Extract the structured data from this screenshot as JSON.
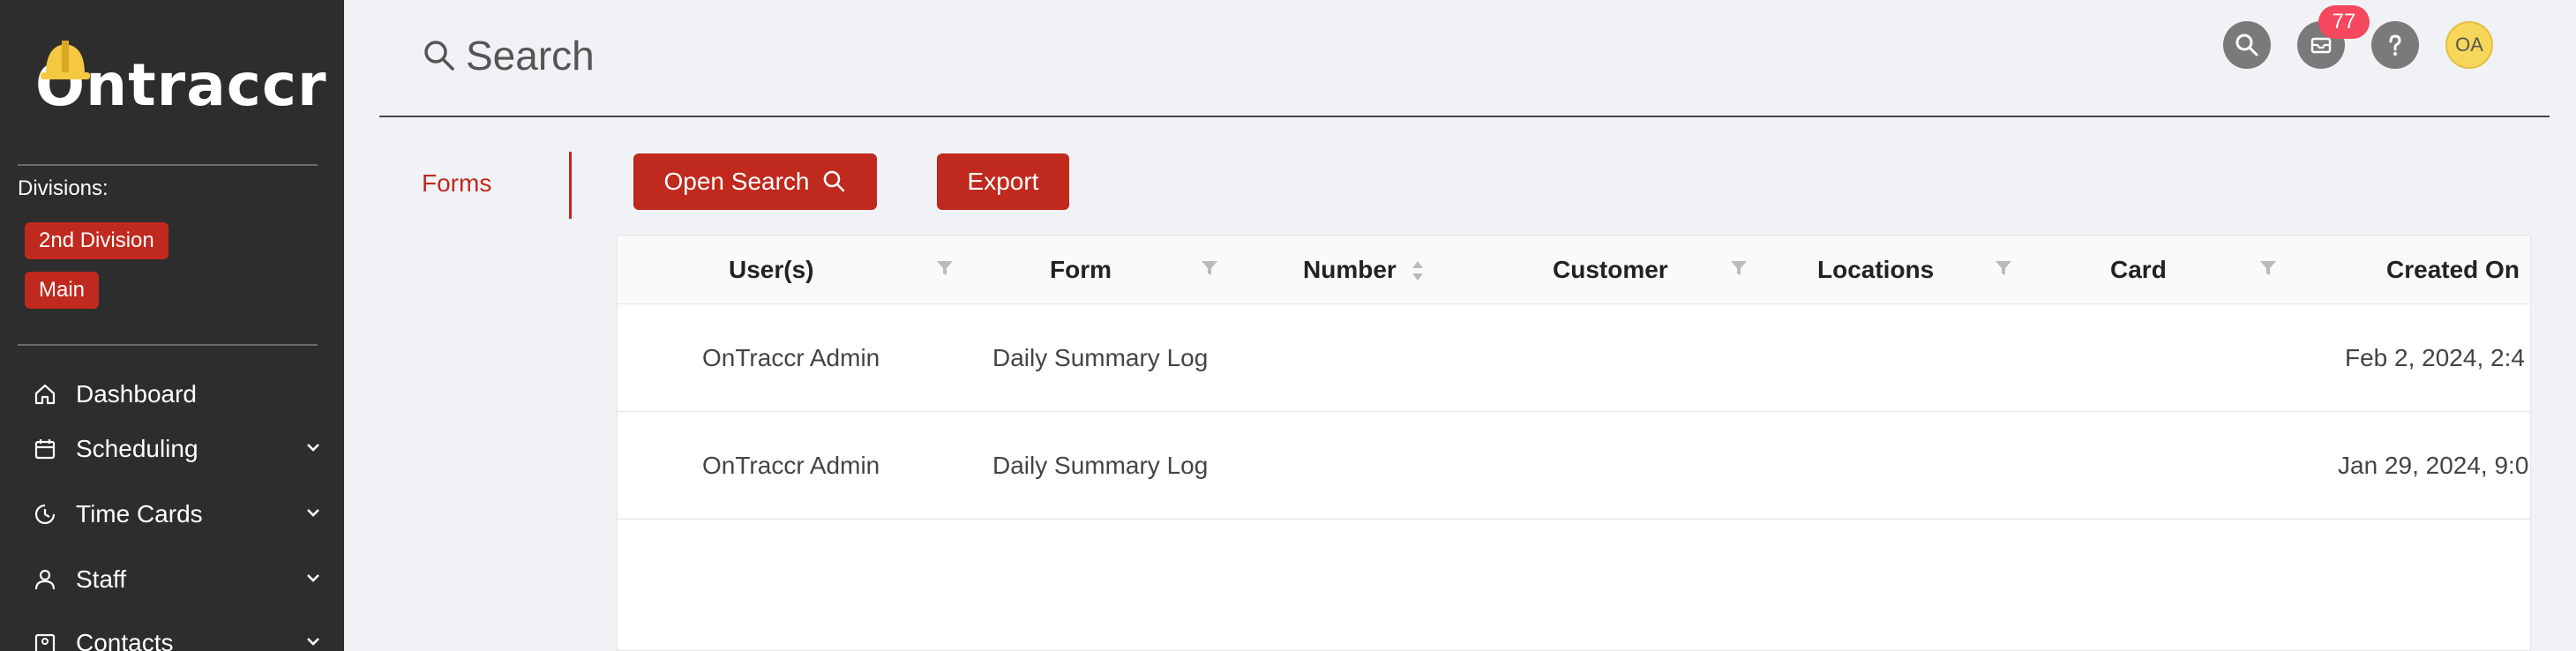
{
  "sidebar": {
    "logo_text": "Ontraccr",
    "divisions_label": "Divisions:",
    "divisions": [
      "2nd Division",
      "Main"
    ],
    "nav": [
      {
        "label": "Dashboard",
        "icon": "home-icon"
      },
      {
        "label": "Scheduling",
        "icon": "calendar-icon"
      },
      {
        "label": "Time Cards",
        "icon": "clock-icon"
      },
      {
        "label": "Staff",
        "icon": "user-icon"
      },
      {
        "label": "Contacts",
        "icon": "contacts-icon"
      }
    ]
  },
  "header": {
    "title": "Search",
    "notification_count": "77",
    "avatar_initials": "OA"
  },
  "tabs": {
    "forms": "Forms"
  },
  "toolbar": {
    "open_search": "Open Search",
    "export": "Export"
  },
  "table": {
    "columns": [
      "User(s)",
      "Form",
      "Number",
      "Customer",
      "Locations",
      "Card",
      "Created On"
    ],
    "rows": [
      {
        "user": "OnTraccr Admin",
        "form": "Daily Summary Log",
        "created": "Feb 2, 2024, 2:4"
      },
      {
        "user": "OnTraccr Admin",
        "form": "Daily Summary Log",
        "created": "Jan 29, 2024, 9:0"
      }
    ]
  },
  "colors": {
    "accent": "#c0291d",
    "sidebar": "#2d2d2d",
    "badge": "#f5475e",
    "avatar": "#f7d75a"
  }
}
